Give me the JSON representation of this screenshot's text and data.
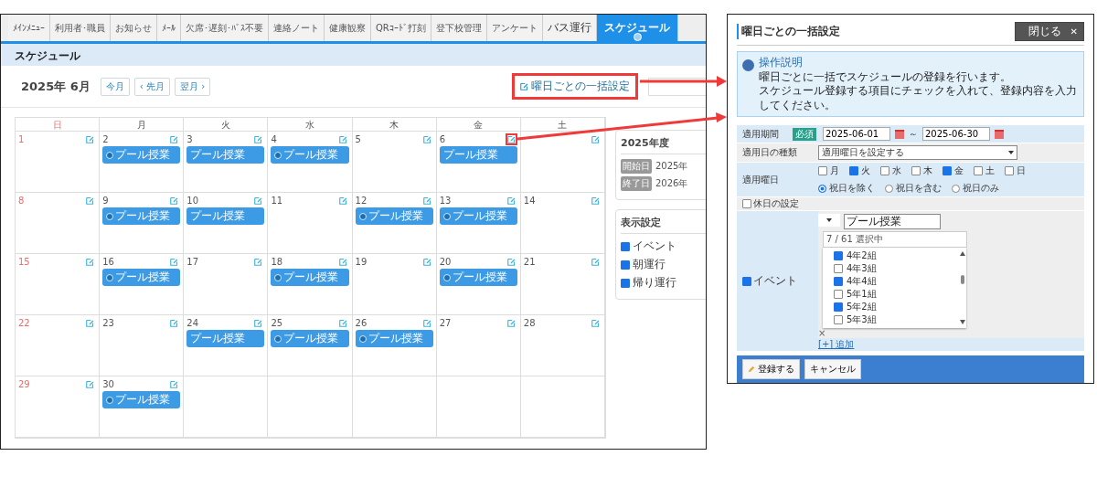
{
  "nav_tabs": [
    {
      "label": "ﾒｲﾝﾒﾆｭｰ",
      "selected": false
    },
    {
      "label": "利用者･職員",
      "selected": false
    },
    {
      "label": "お知らせ",
      "selected": false
    },
    {
      "label": "ﾒｰﾙ",
      "selected": false
    },
    {
      "label": "欠席･遅刻･ﾊﾞｽ不要",
      "selected": false
    },
    {
      "label": "連絡ノート",
      "selected": false
    },
    {
      "label": "健康観察",
      "selected": false
    },
    {
      "label": "QRｺｰﾄﾞ打刻",
      "selected": false
    },
    {
      "label": "登下校管理",
      "selected": false
    },
    {
      "label": "アンケート",
      "selected": false
    },
    {
      "label": "バス運行",
      "selected": false
    },
    {
      "label": "スケジュール",
      "selected": true
    }
  ],
  "page_title": "スケジュール",
  "month": {
    "title": "2025年 6月",
    "buttons": [
      "今月",
      "‹ 先月",
      "翌月 ›"
    ]
  },
  "bulk_button": {
    "label": "曜日ごとの一括設定",
    "highlighted": true
  },
  "calendar": {
    "weekdays": [
      {
        "label": "日",
        "kind": "sunday"
      },
      {
        "label": "月",
        "kind": "weekday"
      },
      {
        "label": "火",
        "kind": "weekday"
      },
      {
        "label": "水",
        "kind": "weekday"
      },
      {
        "label": "木",
        "kind": "weekday"
      },
      {
        "label": "金",
        "kind": "weekday"
      },
      {
        "label": "土",
        "kind": "weekday"
      }
    ],
    "weeks": [
      [
        {
          "day": "1",
          "kind": "sunday"
        },
        {
          "day": "2",
          "kind": "weekday",
          "event": {
            "label": "プール授業",
            "marked": true
          }
        },
        {
          "day": "3",
          "kind": "weekday",
          "event": {
            "label": "プール授業",
            "marked": false
          }
        },
        {
          "day": "4",
          "kind": "weekday",
          "event": {
            "label": "プール授業",
            "marked": true
          }
        },
        {
          "day": "5",
          "kind": "weekday"
        },
        {
          "day": "6",
          "kind": "weekday",
          "highlighted": true,
          "event": {
            "label": "プール授業",
            "marked": false
          }
        },
        {
          "kind": "weekday"
        }
      ],
      [
        {
          "day": "8",
          "kind": "sunday"
        },
        {
          "day": "9",
          "kind": "weekday",
          "event": {
            "label": "プール授業",
            "marked": true
          }
        },
        {
          "day": "10",
          "kind": "weekday",
          "event": {
            "label": "プール授業",
            "marked": false
          }
        },
        {
          "day": "11",
          "kind": "weekday"
        },
        {
          "day": "12",
          "kind": "weekday",
          "event": {
            "label": "プール授業",
            "marked": true
          }
        },
        {
          "day": "13",
          "kind": "weekday",
          "event": {
            "label": "プール授業",
            "marked": true
          }
        },
        {
          "day": "14",
          "kind": "weekday"
        }
      ],
      [
        {
          "day": "15",
          "kind": "sunday"
        },
        {
          "day": "16",
          "kind": "weekday",
          "event": {
            "label": "プール授業",
            "marked": true
          }
        },
        {
          "day": "17",
          "kind": "weekday"
        },
        {
          "day": "18",
          "kind": "weekday",
          "event": {
            "label": "プール授業",
            "marked": true
          }
        },
        {
          "day": "19",
          "kind": "weekday"
        },
        {
          "day": "20",
          "kind": "weekday",
          "event": {
            "label": "プール授業",
            "marked": true
          }
        },
        {
          "day": "21",
          "kind": "weekday"
        }
      ],
      [
        {
          "day": "22",
          "kind": "sunday"
        },
        {
          "day": "23",
          "kind": "weekday"
        },
        {
          "day": "24",
          "kind": "weekday",
          "event": {
            "label": "プール授業",
            "marked": false
          }
        },
        {
          "day": "25",
          "kind": "weekday",
          "event": {
            "label": "プール授業",
            "marked": true
          }
        },
        {
          "day": "26",
          "kind": "weekday",
          "event": {
            "label": "プール授業",
            "marked": true
          }
        },
        {
          "day": "27",
          "kind": "weekday"
        },
        {
          "day": "28",
          "kind": "weekday"
        }
      ],
      [
        {
          "day": "29",
          "kind": "sunday"
        },
        {
          "day": "30",
          "kind": "weekday",
          "event": {
            "label": "プール授業",
            "marked": true
          }
        },
        {
          "kind": "empty"
        },
        {
          "kind": "empty"
        },
        {
          "kind": "empty"
        },
        {
          "kind": "empty"
        },
        {
          "kind": "empty"
        }
      ]
    ]
  },
  "year_panel": {
    "title": "2025年度",
    "rows": [
      {
        "label": "開始日",
        "value": "2025年"
      },
      {
        "label": "終了日",
        "value": "2026年"
      }
    ]
  },
  "display_settings": {
    "title": "表示設定",
    "items": [
      {
        "label": "イベント",
        "checked": true
      },
      {
        "label": "朝運行",
        "checked": true
      },
      {
        "label": "帰り運行",
        "checked": true
      }
    ]
  },
  "dialog": {
    "title": "曜日ごとの一括設定",
    "close": "閉じる",
    "close_icon": "✕",
    "info": {
      "title": "操作説明",
      "lines": [
        "曜日ごとに一括でスケジュールの登録を行います。",
        "スケジュール登録する項目にチェックを入れて、登録内容を入力してください。"
      ]
    },
    "period": {
      "label": "適用期間",
      "badge": "必須",
      "from": "2025-06-01",
      "separator": "～",
      "to": "2025-06-30"
    },
    "day_type": {
      "label": "適用日の種類",
      "value": "適用曜日を設定する"
    },
    "weekdays": {
      "label": "適用曜日",
      "days": [
        {
          "label": "月",
          "checked": false
        },
        {
          "label": "火",
          "checked": true
        },
        {
          "label": "水",
          "checked": false
        },
        {
          "label": "木",
          "checked": false
        },
        {
          "label": "金",
          "checked": true
        },
        {
          "label": "土",
          "checked": false
        },
        {
          "label": "日",
          "checked": false
        }
      ],
      "holiday_options": [
        {
          "label": "祝日を除く",
          "selected": true
        },
        {
          "label": "祝日を含む",
          "selected": false
        },
        {
          "label": "祝日のみ",
          "selected": false
        }
      ]
    },
    "holiday_setting": {
      "label": "休日の設定",
      "checked": false
    },
    "event": {
      "label": "イベント",
      "checked": true,
      "name": "プール授業",
      "count": "7 / 61 選択中",
      "classes": [
        {
          "label": "4年2組",
          "checked": true
        },
        {
          "label": "4年3組",
          "checked": false
        },
        {
          "label": "4年4組",
          "checked": true
        },
        {
          "label": "5年1組",
          "checked": false
        },
        {
          "label": "5年2組",
          "checked": true
        },
        {
          "label": "5年3組",
          "checked": false
        }
      ],
      "remove": "×",
      "add": "[+] 追加"
    },
    "footer": {
      "save": "登録する",
      "cancel": "キャンセル"
    }
  }
}
